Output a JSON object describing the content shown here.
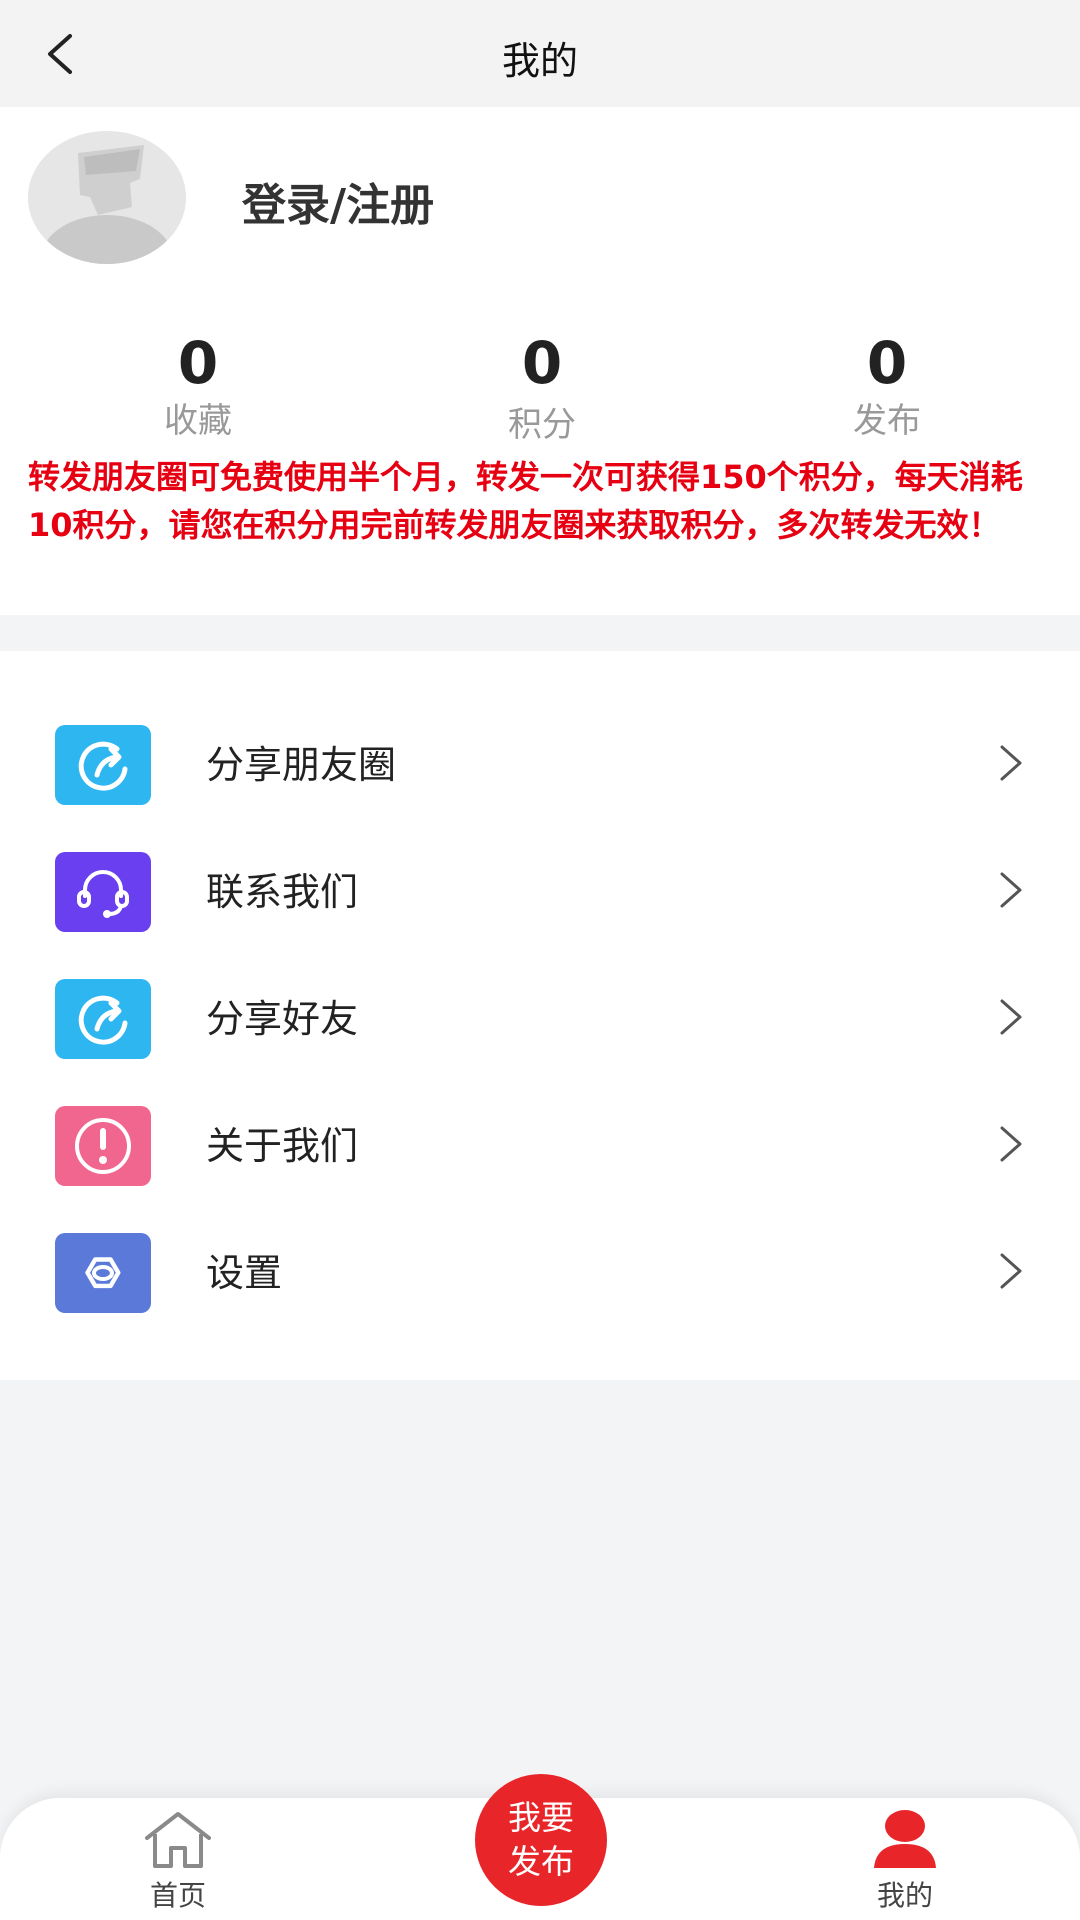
{
  "header": {
    "title": "我的",
    "back_icon": "chevron-left-icon"
  },
  "profile": {
    "login_label": "登录/注册",
    "avatar_icon": "default-avatar-icon",
    "stats": [
      {
        "value": "0",
        "label": "收藏"
      },
      {
        "value": "0",
        "label": "积分"
      },
      {
        "value": "0",
        "label": "发布"
      }
    ],
    "notice": "转发朋友圈可免费使用半个月，转发一次可获得150个积分，每天消耗10积分，请您在积分用完前转发朋友圈来获取积分，多次转发无效！",
    "notice_color": "#e60012"
  },
  "menu": {
    "items": [
      {
        "label": "分享朋友圈",
        "icon": "share-icon",
        "color": "#2db6f0"
      },
      {
        "label": "联系我们",
        "icon": "headset-icon",
        "color": "#6a3ff0"
      },
      {
        "label": "分享好友",
        "icon": "share-icon",
        "color": "#2db6f0"
      },
      {
        "label": "关于我们",
        "icon": "info-icon",
        "color": "#f0668f"
      },
      {
        "label": "设置",
        "icon": "settings-icon",
        "color": "#5b79d9"
      }
    ]
  },
  "tabbar": {
    "home_label": "首页",
    "publish_line1": "我要",
    "publish_line2": "发布",
    "mine_label": "我的",
    "accent_color": "#e8262a"
  }
}
